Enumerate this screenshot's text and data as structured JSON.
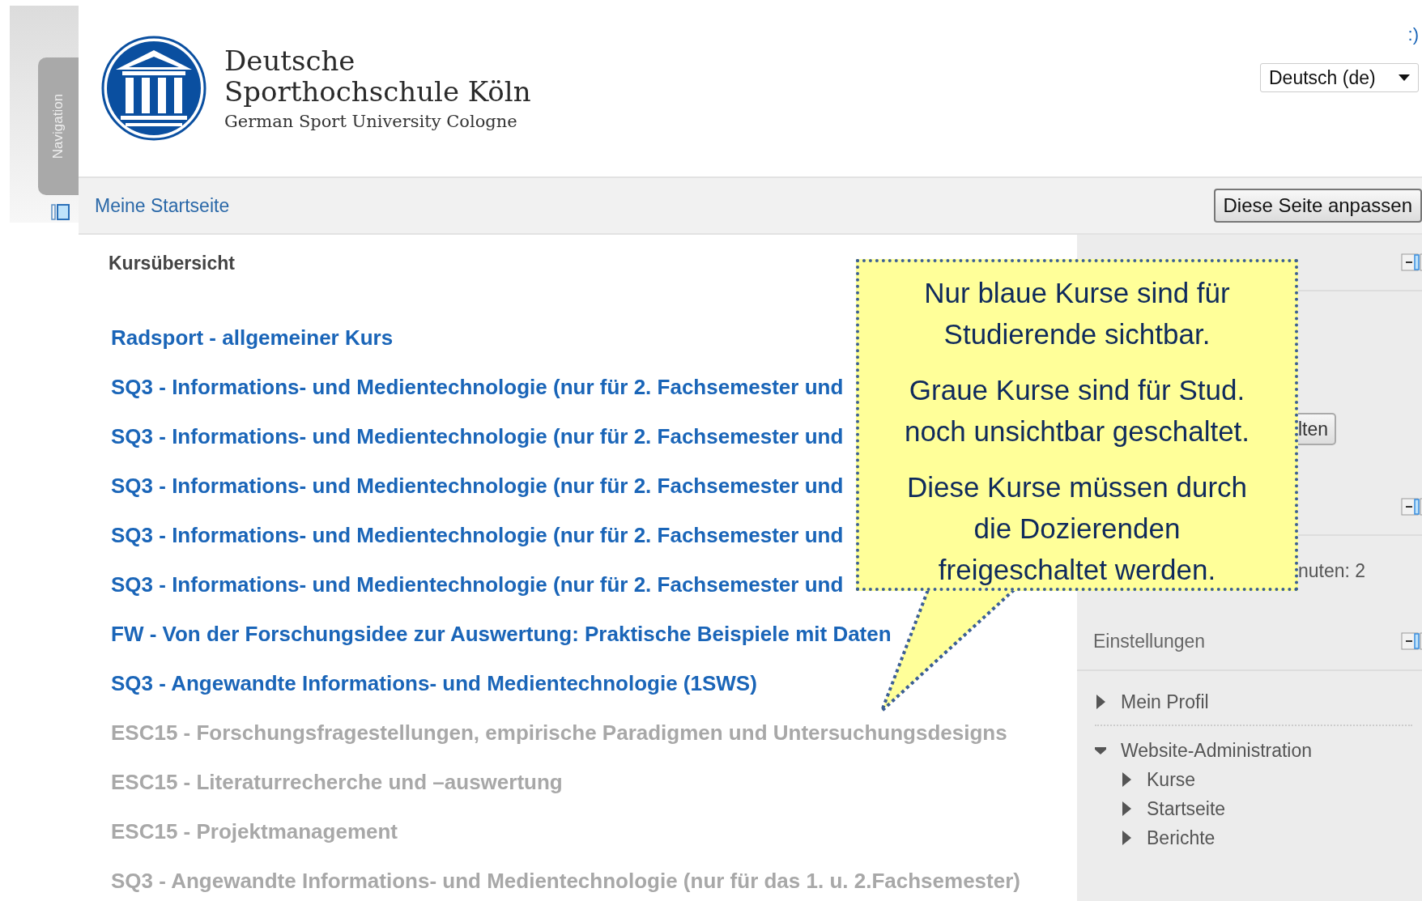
{
  "nav_drawer": {
    "label": "Navigation"
  },
  "logo": {
    "line_1": "Deutsche",
    "line_2": "Sporthochschule Köln",
    "subtitle": "German Sport University Cologne"
  },
  "header": {
    "link_fragment": ":)",
    "language_select": {
      "value": "Deutsch (de)"
    }
  },
  "navbar": {
    "breadcrumb": "Meine Startseite",
    "edit_button": "Diese Seite anpassen"
  },
  "course_overview": {
    "title": "Kursübersicht",
    "courses": [
      {
        "title": "Radsport - allgemeiner Kurs",
        "visible": true
      },
      {
        "title": "SQ3 - Informations- und Medientechnologie (nur für 2. Fachsemester und",
        "visible": true
      },
      {
        "title": "SQ3 - Informations- und Medientechnologie (nur für 2. Fachsemester und",
        "visible": true
      },
      {
        "title": "SQ3 - Informations- und Medientechnologie (nur für 2. Fachsemester und",
        "visible": true
      },
      {
        "title": "SQ3 - Informations- und Medientechnologie (nur für 2. Fachsemester und",
        "visible": true
      },
      {
        "title": "SQ3 - Informations- und Medientechnologie (nur für 2. Fachsemester und",
        "visible": true
      },
      {
        "title": "FW - Von der Forschungsidee zur Auswertung: Praktische Beispiele mit Daten",
        "visible": true
      },
      {
        "title": "SQ3 - Angewandte Informations- und Medientechnologie (1SWS)",
        "visible": true
      },
      {
        "title": "ESC15 - Forschungsfragestellungen, empirische Paradigmen und Untersuchungsdesigns",
        "visible": false
      },
      {
        "title": "ESC15 - Literaturrecherche und –auswertung",
        "visible": false
      },
      {
        "title": "ESC15 - Projektmanagement",
        "visible": false
      },
      {
        "title": "SQ3 - Angewandte Informations- und Medientechnologie (nur für das 1. u. 2.Fachsemester)",
        "visible": false
      }
    ]
  },
  "sidebar": {
    "files_block": {
      "button_fragment": "lten"
    },
    "online_block": {
      "text_fragment": "nuten: 2"
    },
    "settings_block": {
      "title": "Einstellungen",
      "items": [
        {
          "label": "Mein Profil",
          "expanded": false
        },
        {
          "label": "Website-Administration",
          "expanded": true,
          "children": [
            {
              "label": "Kurse",
              "expanded": false
            },
            {
              "label": "Startseite",
              "expanded": false
            },
            {
              "label": "Berichte",
              "expanded": false
            }
          ]
        }
      ]
    }
  },
  "callout": {
    "paragraphs": [
      {
        "lines": [
          "Nur blaue Kurse sind für",
          "Studierende sichtbar."
        ]
      },
      {
        "lines": [
          "Graue Kurse sind für Stud.",
          "noch unsichtbar geschaltet."
        ]
      },
      {
        "lines": [
          "Diese Kurse müssen durch",
          "die Dozierenden",
          "freigeschaltet werden."
        ]
      }
    ]
  }
}
